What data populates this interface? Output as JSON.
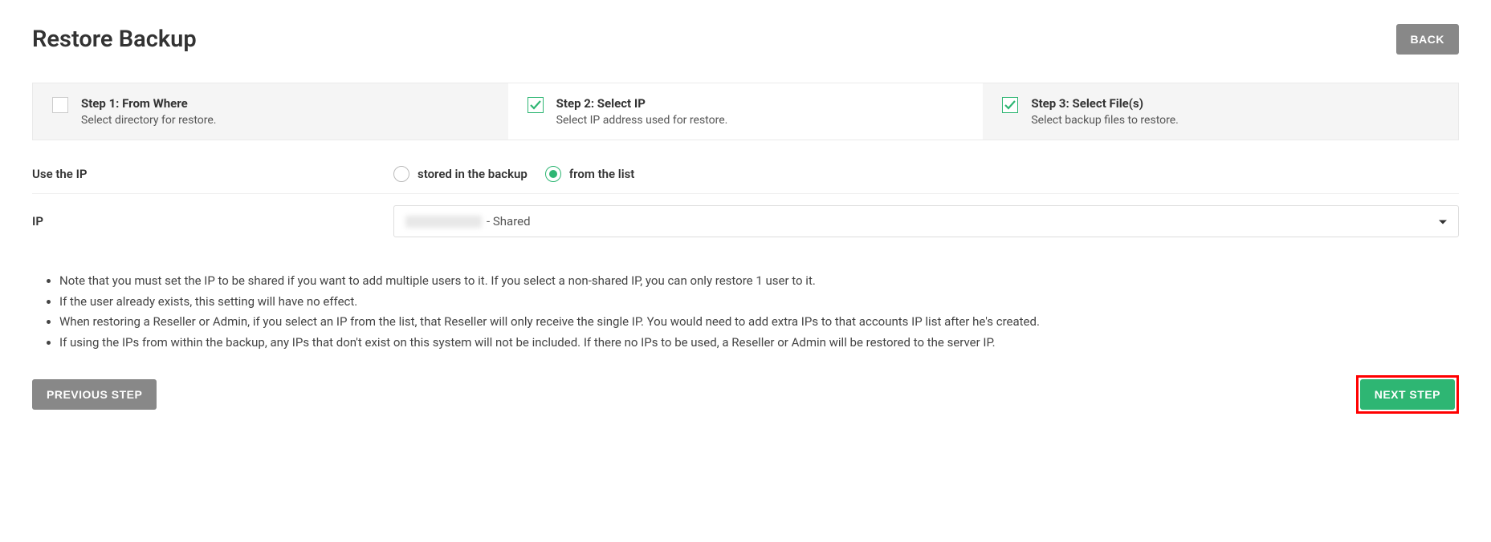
{
  "header": {
    "title": "Restore Backup",
    "back_label": "BACK"
  },
  "steps": [
    {
      "title": "Step 1: From Where",
      "desc": "Select directory for restore.",
      "checked": false
    },
    {
      "title": "Step 2: Select IP",
      "desc": "Select IP address used for restore.",
      "checked": true
    },
    {
      "title": "Step 3: Select File(s)",
      "desc": "Select backup files to restore.",
      "checked": true
    }
  ],
  "form": {
    "use_ip_label": "Use the IP",
    "radio_stored": "stored in the backup",
    "radio_list": "from the list",
    "ip_label": "IP",
    "ip_select_suffix": " - Shared"
  },
  "notes": [
    "Note that you must set the IP to be shared if you want to add multiple users to it. If you select a non-shared IP, you can only restore 1 user to it.",
    "If the user already exists, this setting will have no effect.",
    "When restoring a Reseller or Admin, if you select an IP from the list, that Reseller will only receive the single IP. You would need to add extra IPs to that accounts IP list after he's created.",
    "If using the IPs from within the backup, any IPs that don't exist on this system will not be included. If there no IPs to be used, a Reseller or Admin will be restored to the server IP."
  ],
  "footer": {
    "prev_label": "PREVIOUS STEP",
    "next_label": "NEXT STEP"
  }
}
